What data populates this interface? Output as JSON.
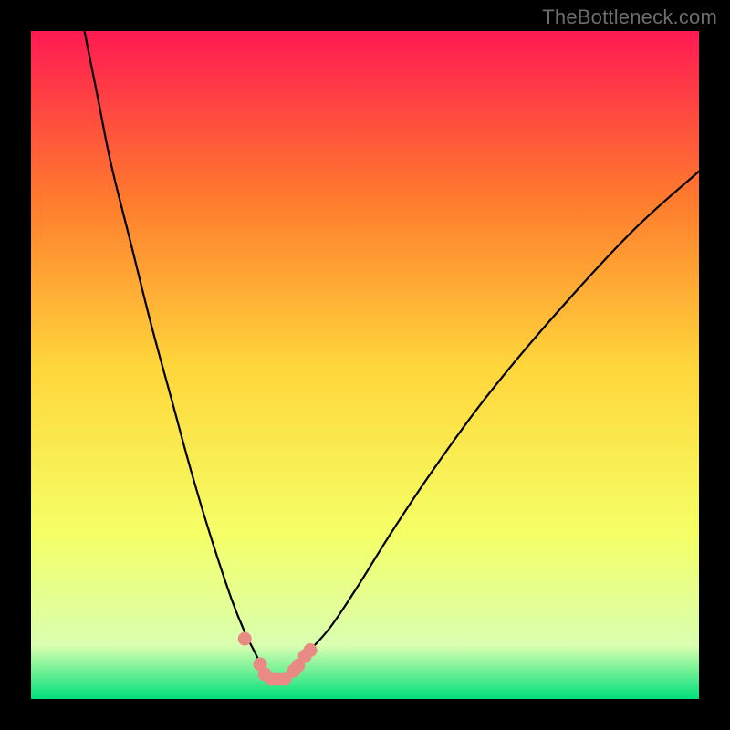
{
  "watermark": "TheBottleneck.com",
  "chart_data": {
    "type": "line",
    "title": "",
    "xlabel": "",
    "ylabel": "",
    "xlim": [
      0,
      100
    ],
    "ylim": [
      0,
      100
    ],
    "background": {
      "stops": [
        {
          "offset": 0,
          "color": "#ff1a52"
        },
        {
          "offset": 25,
          "color": "#ff7a2e"
        },
        {
          "offset": 50,
          "color": "#ffd63a"
        },
        {
          "offset": 75,
          "color": "#f5ff66"
        },
        {
          "offset": 92,
          "color": "#d9ffb0"
        },
        {
          "offset": 100,
          "color": "#00e07a"
        }
      ]
    },
    "series": [
      {
        "name": "left-curve",
        "x": [
          8,
          10,
          12,
          15,
          18,
          21,
          24,
          27,
          30,
          32,
          33.5,
          34.5,
          35.3,
          36,
          37
        ],
        "y": [
          0,
          10,
          20,
          32,
          44,
          55,
          66,
          76,
          85,
          90,
          93,
          95,
          96,
          96.8,
          97
        ]
      },
      {
        "name": "right-curve",
        "x": [
          37,
          38,
          39,
          40,
          42,
          45,
          49,
          54,
          60,
          68,
          78,
          90,
          100
        ],
        "y": [
          97,
          96.8,
          96,
          95,
          92.5,
          89,
          83,
          75,
          66,
          55,
          43,
          30,
          21
        ]
      }
    ],
    "markers": {
      "name": "bottom-dots",
      "color": "#e98a85",
      "points": [
        {
          "x": 32.0,
          "y": 91.0
        },
        {
          "x": 34.3,
          "y": 94.8
        },
        {
          "x": 35.0,
          "y": 96.3
        },
        {
          "x": 36.0,
          "y": 97.0
        },
        {
          "x": 37.0,
          "y": 97.0
        },
        {
          "x": 38.0,
          "y": 97.0
        },
        {
          "x": 39.3,
          "y": 95.8
        },
        {
          "x": 40.0,
          "y": 95.0
        },
        {
          "x": 41.0,
          "y": 93.6
        },
        {
          "x": 41.8,
          "y": 92.7
        }
      ]
    }
  }
}
